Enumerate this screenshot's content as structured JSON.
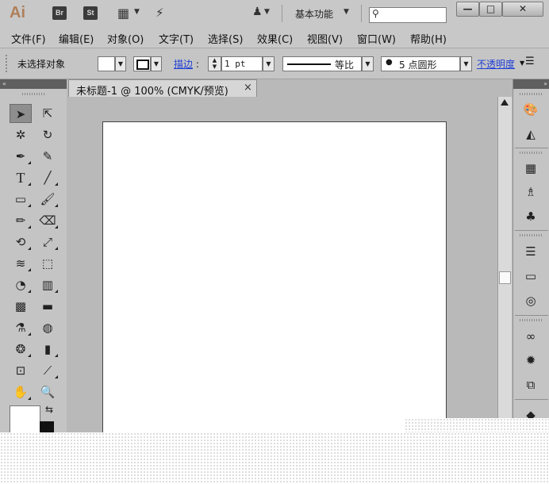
{
  "titlebar": {
    "app_logo": "Ai",
    "bridge_label": "Br",
    "stock_label": "St",
    "workspace_label": "基本功能",
    "search_value": "",
    "minimize": "—",
    "maximize": "□",
    "close": "✕"
  },
  "menubar": {
    "items": [
      "文件(F)",
      "编辑(E)",
      "对象(O)",
      "文字(T)",
      "选择(S)",
      "效果(C)",
      "视图(V)",
      "窗口(W)",
      "帮助(H)"
    ]
  },
  "controlbar": {
    "selection_status": "未选择对象",
    "stroke_link": "描边",
    "stroke_colon": ":",
    "stroke_weight": "1 pt",
    "profile_label": "等比",
    "brush_label": "5 点圆形",
    "brush_dot": "●",
    "opacity_link": "不透明度"
  },
  "document": {
    "tab_title": "未标题-1 @ 100% (CMYK/预览)",
    "tab_close": "×"
  },
  "panels": {
    "collapse_left": "«",
    "collapse_right": "»"
  },
  "colors": {
    "app_bg": "#b9b9b9",
    "chrome": "#c8c8c8",
    "link": "#1f3fd6",
    "logo": "#b07f5a"
  },
  "icons": [
    "selection-tool",
    "direct-selection-tool",
    "magic-wand-tool",
    "lasso-tool",
    "pen-tool",
    "curvature-tool",
    "type-tool",
    "line-tool",
    "rectangle-tool",
    "paintbrush-tool",
    "pencil-tool",
    "eraser-tool",
    "rotate-tool",
    "scale-tool",
    "width-tool",
    "free-transform-tool",
    "shape-builder-tool",
    "perspective-grid-tool",
    "mesh-tool",
    "gradient-tool",
    "eyedropper-tool",
    "blend-tool",
    "symbol-sprayer-tool",
    "column-graph-tool",
    "artboard-tool",
    "slice-tool",
    "hand-tool",
    "zoom-tool",
    "color-guide-icon",
    "color-panel-icon",
    "swatches-icon",
    "brushes-icon",
    "symbols-icon",
    "stroke-icon",
    "gradient-icon",
    "transparency-icon",
    "cc-libraries-icon",
    "appearance-icon",
    "graphic-styles-icon"
  ]
}
